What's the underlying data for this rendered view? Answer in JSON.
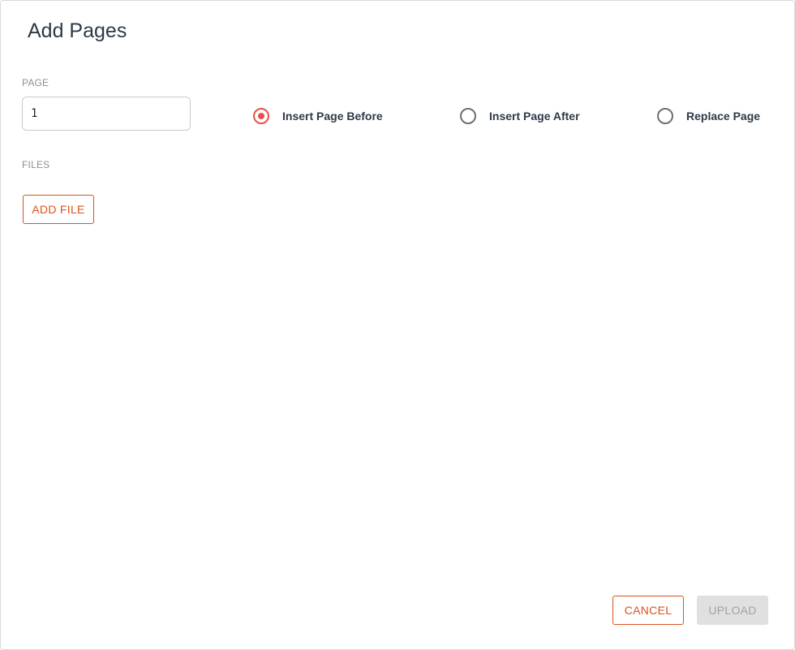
{
  "dialog": {
    "title": "Add Pages"
  },
  "page_field": {
    "label": "PAGE",
    "value": "1"
  },
  "insert_mode": {
    "selected": "before",
    "options": [
      {
        "id": "before",
        "label": "Insert Page Before",
        "checked": true
      },
      {
        "id": "after",
        "label": "Insert Page After",
        "checked": false
      },
      {
        "id": "replace",
        "label": "Replace Page",
        "checked": false
      }
    ]
  },
  "files": {
    "label": "FILES",
    "add_button_label": "ADD FILE"
  },
  "footer": {
    "cancel_label": "CANCEL",
    "upload_label": "UPLOAD",
    "upload_disabled": true
  },
  "colors": {
    "accent": "#d9531e",
    "radio_checked": "#e8504a",
    "title_text": "#2d3a48",
    "disabled_bg": "#e0e0e0",
    "disabled_text": "#a3a3a3"
  }
}
